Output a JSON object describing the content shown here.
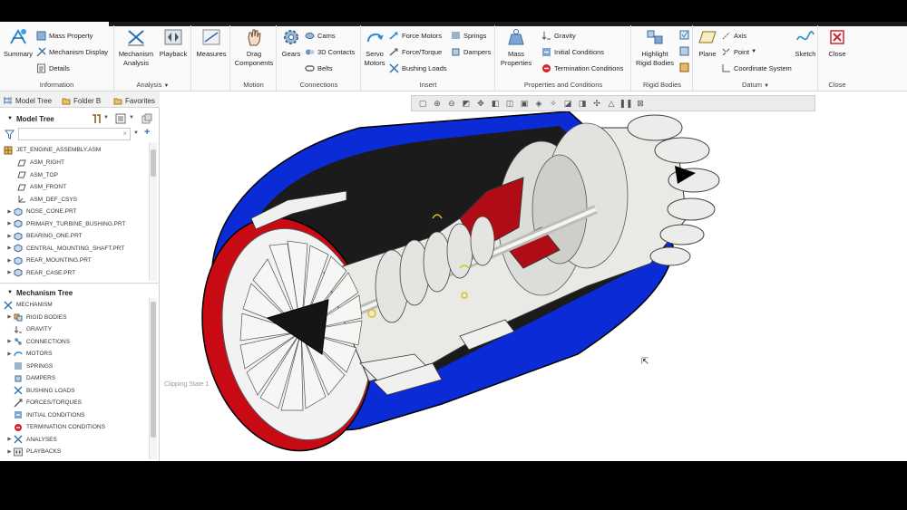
{
  "ribbon": {
    "groups": {
      "information": "Information",
      "analysis": "Analysis",
      "motion": "Motion",
      "connections": "Connections",
      "insert": "Insert",
      "properties": "Properties and Conditions",
      "rigid_bodies": "Rigid Bodies",
      "datum": "Datum",
      "close": "Close"
    },
    "buttons": {
      "summary": "Summary",
      "mass_property": "Mass Property",
      "mechanism_display": "Mechanism Display",
      "details": "Details",
      "mechanism_analysis_1": "Mechanism",
      "mechanism_analysis_2": "Analysis",
      "playback": "Playback",
      "measures": "Measures",
      "drag_components_1": "Drag",
      "drag_components_2": "Components",
      "gears": "Gears",
      "cams": "Cams",
      "contacts_3d": "3D Contacts",
      "belts": "Belts",
      "servo_motors_1": "Servo",
      "servo_motors_2": "Motors",
      "force_motors": "Force Motors",
      "force_torque": "Force/Torque",
      "bushing_loads": "Bushing Loads",
      "springs": "Springs",
      "dampers": "Dampers",
      "mass_properties_1": "Mass",
      "mass_properties_2": "Properties",
      "gravity": "Gravity",
      "initial_conditions": "Initial Conditions",
      "termination_conditions": "Termination Conditions",
      "highlight_rigid_bodies_1": "Highlight",
      "highlight_rigid_bodies_2": "Rigid Bodies",
      "plane": "Plane",
      "axis": "Axis",
      "point": "Point",
      "coordinate_system": "Coordinate System",
      "sketch": "Sketch",
      "close": "Close"
    }
  },
  "panel": {
    "tabs": [
      "Model Tree",
      "Folder B",
      "Favorites"
    ],
    "model_tree_title": "Model Tree",
    "mechanism_tree_title": "Mechanism Tree",
    "model_items": [
      "JET_ENGINE_ASSEMBLY.ASM",
      "ASM_RIGHT",
      "ASM_TOP",
      "ASM_FRONT",
      "ASM_DEF_CSYS",
      "NOSE_CONE.PRT",
      "PRIMARY_TURBINE_BUSHING.PRT",
      "BEARING_ONE.PRT",
      "CENTRAL_MOUNTING_SHAFT.PRT",
      "REAR_MOUNTING.PRT",
      "REAR_CASE.PRT"
    ],
    "mechanism_items": [
      "MECHANISM",
      "RIGID BODIES",
      "GRAVITY",
      "CONNECTIONS",
      "MOTORS",
      "SPRINGS",
      "DAMPERS",
      "BUSHING LOADS",
      "FORCES/TORQUES",
      "INITIAL CONDITIONS",
      "TERMINATION CONDITIONS",
      "ANALYSES",
      "PLAYBACKS"
    ]
  },
  "viewport": {
    "clipping_label": "Clipping State 1"
  },
  "colors": {
    "accent_blue": "#0a2bd6",
    "engine_red": "#c80a14",
    "close_red": "#d0232a"
  }
}
